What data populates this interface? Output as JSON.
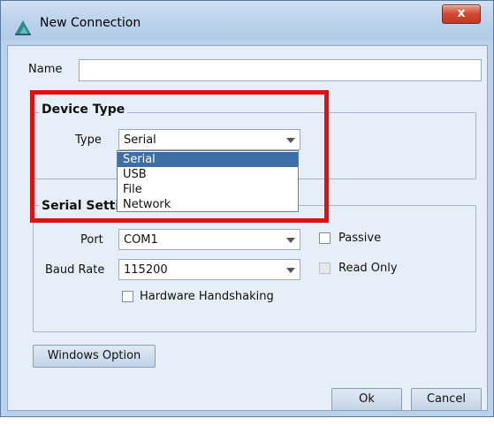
{
  "window": {
    "title": "New Connection",
    "close_glyph": "x"
  },
  "name_field": {
    "label": "Name",
    "value": ""
  },
  "device_type": {
    "group_title": "Device Type",
    "type_label": "Type",
    "selected": "Serial",
    "options": [
      "Serial",
      "USB",
      "File",
      "Network"
    ]
  },
  "serial_settings": {
    "group_title": "Serial Settings",
    "port_label": "Port",
    "port_value": "COM1",
    "baud_label": "Baud Rate",
    "baud_value": "115200",
    "handshake_label": "Hardware Handshaking",
    "passive_label": "Passive",
    "readonly_label": "Read Only"
  },
  "buttons": {
    "windows_option": "Windows Option",
    "ok": "Ok",
    "cancel": "Cancel"
  },
  "colors": {
    "highlight_box": "#e01010",
    "selection": "#3d6fa6"
  }
}
